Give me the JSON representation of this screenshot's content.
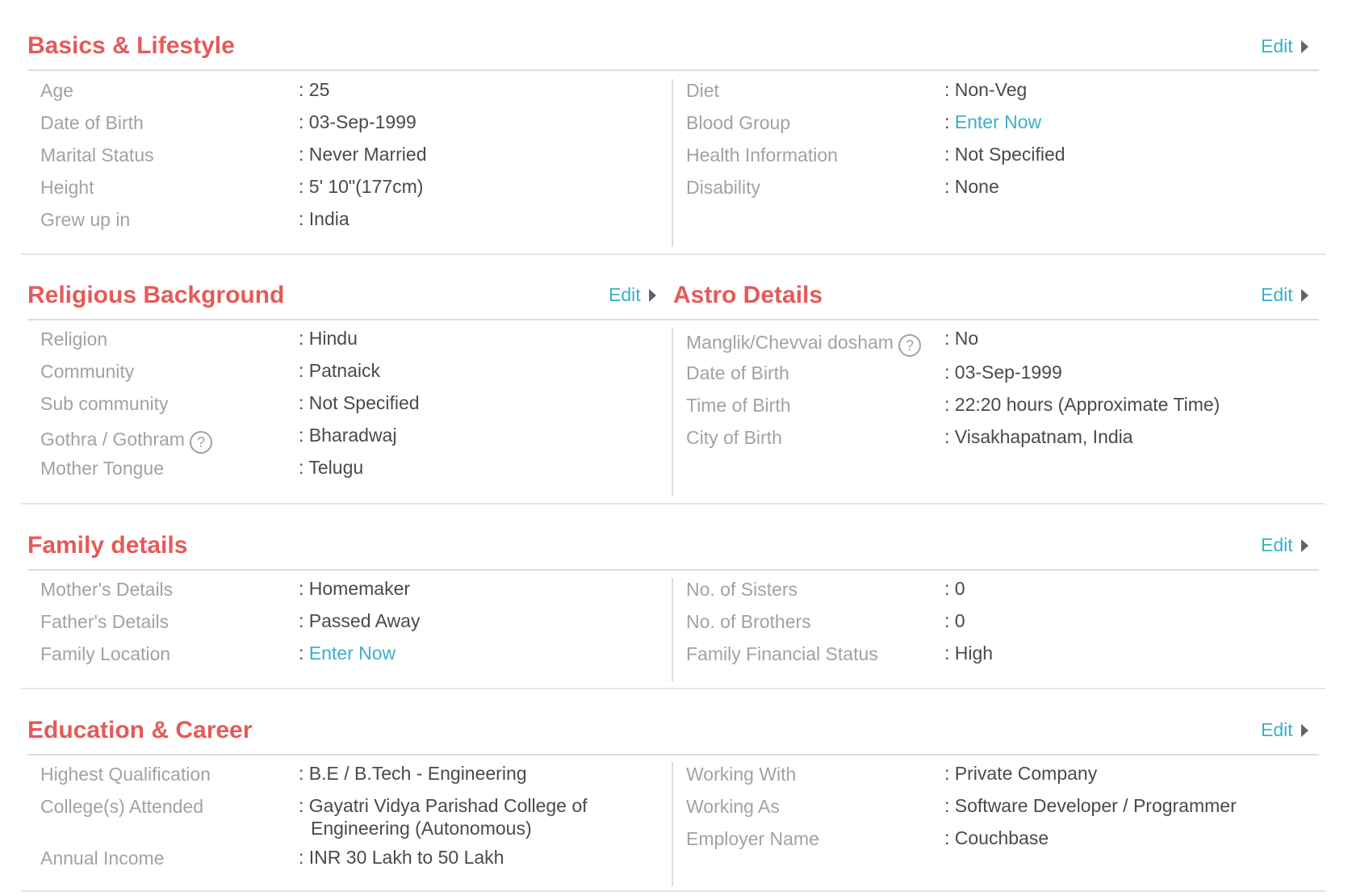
{
  "sections": {
    "basics": {
      "title": "Basics & Lifestyle",
      "edit": "Edit",
      "left": [
        {
          "label": "Age",
          "value": "25"
        },
        {
          "label": "Date of Birth",
          "value": "03-Sep-1999"
        },
        {
          "label": "Marital Status",
          "value": "Never Married"
        },
        {
          "label": "Height",
          "value": "5' 10\"(177cm)"
        },
        {
          "label": "Grew up in",
          "value": "India"
        }
      ],
      "right": [
        {
          "label": "Diet",
          "value": "Non-Veg"
        },
        {
          "label": "Blood Group",
          "value": "Enter Now"
        },
        {
          "label": "Health Information",
          "value": "Not Specified"
        },
        {
          "label": "Disability",
          "value": "None"
        }
      ]
    },
    "religious": {
      "title": "Religious Background",
      "edit": "Edit",
      "rows": [
        {
          "label": "Religion",
          "value": "Hindu"
        },
        {
          "label": "Community",
          "value": "Patnaick"
        },
        {
          "label": "Sub community",
          "value": "Not Specified"
        },
        {
          "label": "Gothra / Gothram",
          "value": "Bharadwaj"
        },
        {
          "label": "Mother Tongue",
          "value": "Telugu"
        }
      ]
    },
    "astro": {
      "title": "Astro Details",
      "edit": "Edit",
      "rows": [
        {
          "label": "Manglik/Chevvai dosham",
          "value": "No"
        },
        {
          "label": "Date of Birth",
          "value": "03-Sep-1999"
        },
        {
          "label": "Time of Birth",
          "value": "22:20 hours (Approximate Time)"
        },
        {
          "label": "City of Birth",
          "value": "Visakhapatnam, India"
        }
      ]
    },
    "family": {
      "title": "Family details",
      "edit": "Edit",
      "left": [
        {
          "label": "Mother's Details",
          "value": "Homemaker"
        },
        {
          "label": "Father's Details",
          "value": "Passed Away"
        },
        {
          "label": "Family Location",
          "value": "Enter Now"
        }
      ],
      "right": [
        {
          "label": "No. of Sisters",
          "value": "0"
        },
        {
          "label": "No. of Brothers",
          "value": "0"
        },
        {
          "label": "Family Financial Status",
          "value": "High"
        }
      ]
    },
    "education": {
      "title": "Education & Career",
      "edit": "Edit",
      "left": [
        {
          "label": "Highest Qualification",
          "value": "B.E / B.Tech - Engineering"
        },
        {
          "label": "College(s) Attended",
          "value_line1": "Gayatri Vidya Parishad College of",
          "value_line2": "Engineering (Autonomous)"
        },
        {
          "label": "Annual Income",
          "value": "INR 30 Lakh to 50 Lakh"
        }
      ],
      "right": [
        {
          "label": "Working With",
          "value": "Private Company"
        },
        {
          "label": "Working As",
          "value": "Software Developer / Programmer"
        },
        {
          "label": "Employer Name",
          "value": "Couchbase"
        }
      ]
    }
  },
  "separator": ": ",
  "help_glyph": "?",
  "icons": {
    "edit_caret": "caret-right-icon",
    "help": "question-circle-icon"
  },
  "colors": {
    "title": "#e55a5a",
    "link": "#3bb0c9",
    "label": "#a2a2a2",
    "value": "#4a4a4a",
    "divider": "#dcdcdc"
  }
}
